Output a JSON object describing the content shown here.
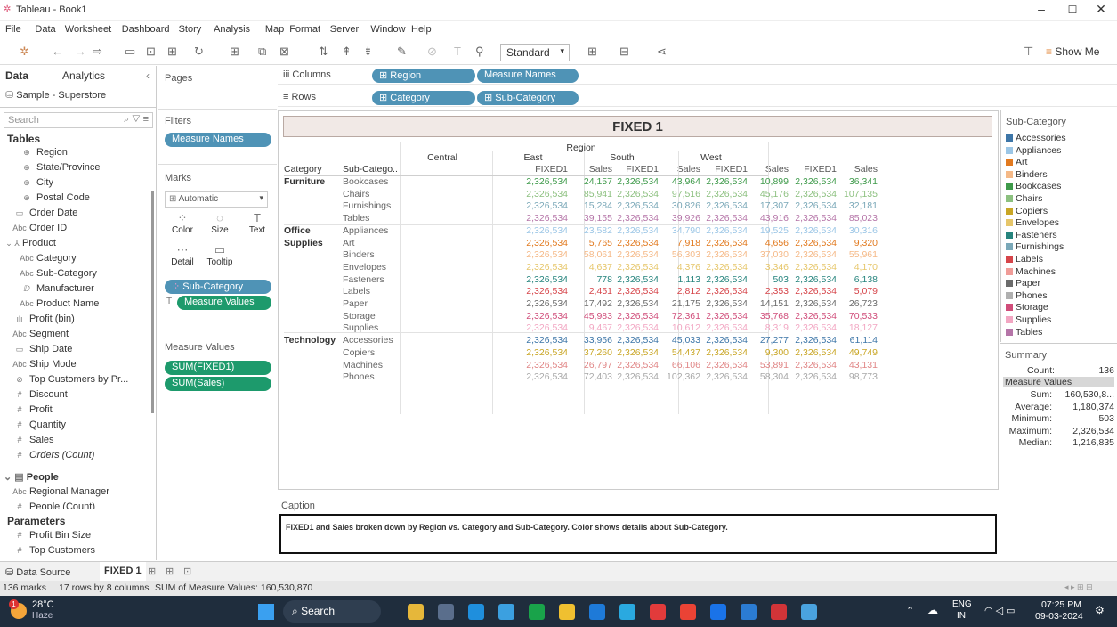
{
  "window": {
    "title": "Tableau - Book1",
    "minimize": "–",
    "maximize": "☐",
    "close": "✕"
  },
  "menu": [
    "File",
    "Data",
    "Worksheet",
    "Dashboard",
    "Story",
    "Analysis",
    "Map",
    "Format",
    "Server",
    "Window",
    "Help"
  ],
  "toolbar": {
    "mark_type": "Standard",
    "show_me": "Show Me"
  },
  "data_pane": {
    "tab_data": "Data",
    "tab_analytics": "Analytics",
    "datasource": "Sample - Superstore",
    "search_placeholder": "Search",
    "tables_label": "Tables",
    "fields": [
      {
        "glyph": "⊕",
        "label": "Region",
        "indent": 2
      },
      {
        "glyph": "⊕",
        "label": "State/Province",
        "indent": 2
      },
      {
        "glyph": "⊕",
        "label": "City",
        "indent": 2
      },
      {
        "glyph": "⊕",
        "label": "Postal Code",
        "indent": 2
      },
      {
        "glyph": "▭",
        "label": "Order Date",
        "indent": 1
      },
      {
        "glyph": "Abc",
        "label": "Order ID",
        "indent": 1
      },
      {
        "glyph": "⌄ ⅄",
        "label": "Product",
        "indent": 0
      },
      {
        "glyph": "Abc",
        "label": "Category",
        "indent": 2
      },
      {
        "glyph": "Abc",
        "label": "Sub-Category",
        "indent": 2
      },
      {
        "glyph": "ⅅ",
        "label": "Manufacturer",
        "indent": 2
      },
      {
        "glyph": "Abc",
        "label": "Product Name",
        "indent": 2
      },
      {
        "glyph": "ılı",
        "label": "Profit (bin)",
        "indent": 1
      },
      {
        "glyph": "Abc",
        "label": "Segment",
        "indent": 1
      },
      {
        "glyph": "▭",
        "label": "Ship Date",
        "indent": 1
      },
      {
        "glyph": "Abc",
        "label": "Ship Mode",
        "indent": 1
      },
      {
        "glyph": "⊘",
        "label": "Top Customers by Pr...",
        "indent": 1
      },
      {
        "glyph": "#",
        "label": "Discount",
        "indent": 1
      },
      {
        "glyph": "#",
        "label": "Profit",
        "indent": 1
      },
      {
        "glyph": "#",
        "label": "Quantity",
        "indent": 1
      },
      {
        "glyph": "#",
        "label": "Sales",
        "indent": 1
      },
      {
        "glyph": "#",
        "label": "Orders (Count)",
        "indent": 1,
        "italic": true
      }
    ],
    "people_label": "People",
    "people_fields": [
      {
        "glyph": "Abc",
        "label": "Regional Manager"
      },
      {
        "glyph": "#",
        "label": "People (Count)"
      }
    ],
    "parameters_label": "Parameters",
    "parameters": [
      "Profit Bin Size",
      "Top Customers"
    ]
  },
  "cards": {
    "pages": "Pages",
    "filters": "Filters",
    "filter_pill": "Measure Names",
    "marks": "Marks",
    "mark_type": "Automatic",
    "mark_buttons": [
      {
        "icon": "⁘",
        "label": "Color"
      },
      {
        "icon": "◌",
        "label": "Size"
      },
      {
        "icon": "T",
        "label": "Text"
      },
      {
        "icon": "⋯",
        "label": "Detail"
      },
      {
        "icon": "▭",
        "label": "Tooltip"
      }
    ],
    "color_pill": "Sub-Category",
    "text_pill": "Measure Values",
    "measure_values": "Measure Values",
    "mv_pills": [
      "SUM(FIXED1)",
      "SUM(Sales)"
    ]
  },
  "shelves": {
    "columns_label": "Columns",
    "rows_label": "Rows",
    "columns": [
      "Region",
      "Measure Names"
    ],
    "rows": [
      "Category",
      "Sub-Category"
    ]
  },
  "view": {
    "title": "FIXED 1",
    "region_header": "Region",
    "category_header": "Category",
    "subcat_header": "Sub-Catego..",
    "regions": [
      "Central",
      "East",
      "South",
      "West"
    ],
    "measures": [
      "FIXED1",
      "Sales"
    ],
    "rows": [
      {
        "cat": "Furniture",
        "sub": "Bookcases",
        "color": "#3e9a4a",
        "vals": [
          "2,326,534",
          "24,157",
          "2,326,534",
          "43,964",
          "2,326,534",
          "10,899",
          "2,326,534",
          "36,341"
        ]
      },
      {
        "cat": "",
        "sub": "Chairs",
        "color": "#8cc07f",
        "vals": [
          "2,326,534",
          "85,941",
          "2,326,534",
          "97,516",
          "2,326,534",
          "45,176",
          "2,326,534",
          "107,135"
        ]
      },
      {
        "cat": "",
        "sub": "Furnishings",
        "color": "#7aa8b8",
        "vals": [
          "2,326,534",
          "15,284",
          "2,326,534",
          "30,826",
          "2,326,534",
          "17,307",
          "2,326,534",
          "32,181"
        ]
      },
      {
        "cat": "",
        "sub": "Tables",
        "color": "#b575a8",
        "vals": [
          "2,326,534",
          "39,155",
          "2,326,534",
          "39,926",
          "2,326,534",
          "43,916",
          "2,326,534",
          "85,023"
        ]
      },
      {
        "cat": "Office",
        "sub": "Appliances",
        "color": "#9bc6e6",
        "vals": [
          "2,326,534",
          "23,582",
          "2,326,534",
          "34,790",
          "2,326,534",
          "19,525",
          "2,326,534",
          "30,316"
        ]
      },
      {
        "cat": "Supplies",
        "sub": "Art",
        "color": "#e27a1f",
        "vals": [
          "2,326,534",
          "5,765",
          "2,326,534",
          "7,918",
          "2,326,534",
          "4,656",
          "2,326,534",
          "9,320"
        ]
      },
      {
        "cat": "",
        "sub": "Binders",
        "color": "#f5b987",
        "vals": [
          "2,326,534",
          "58,061",
          "2,326,534",
          "56,303",
          "2,326,534",
          "37,030",
          "2,326,534",
          "55,961"
        ]
      },
      {
        "cat": "",
        "sub": "Envelopes",
        "color": "#e6c66a",
        "vals": [
          "2,326,534",
          "4,637",
          "2,326,534",
          "4,376",
          "2,326,534",
          "3,346",
          "2,326,534",
          "4,170"
        ]
      },
      {
        "cat": "",
        "sub": "Fasteners",
        "color": "#26847d",
        "vals": [
          "2,326,534",
          "778",
          "2,326,534",
          "1,113",
          "2,326,534",
          "503",
          "2,326,534",
          "6,138"
        ]
      },
      {
        "cat": "",
        "sub": "Labels",
        "color": "#d6454a",
        "vals": [
          "2,326,534",
          "2,451",
          "2,326,534",
          "2,812",
          "2,326,534",
          "2,353",
          "2,326,534",
          "5,079"
        ]
      },
      {
        "cat": "",
        "sub": "Paper",
        "color": "#6b6b6b",
        "vals": [
          "2,326,534",
          "17,492",
          "2,326,534",
          "21,175",
          "2,326,534",
          "14,151",
          "2,326,534",
          "26,723"
        ]
      },
      {
        "cat": "",
        "sub": "Storage",
        "color": "#d04d7a",
        "vals": [
          "2,326,534",
          "45,983",
          "2,326,534",
          "72,361",
          "2,326,534",
          "35,768",
          "2,326,534",
          "70,533"
        ]
      },
      {
        "cat": "",
        "sub": "Supplies",
        "color": "#f2a6c2",
        "vals": [
          "2,326,534",
          "9,467",
          "2,326,534",
          "10,612",
          "2,326,534",
          "8,319",
          "2,326,534",
          "18,127"
        ]
      },
      {
        "cat": "Technology",
        "sub": "Accessories",
        "color": "#3d76a8",
        "vals": [
          "2,326,534",
          "33,956",
          "2,326,534",
          "45,033",
          "2,326,534",
          "27,277",
          "2,326,534",
          "61,114"
        ]
      },
      {
        "cat": "",
        "sub": "Copiers",
        "color": "#c9a625",
        "vals": [
          "2,326,534",
          "37,260",
          "2,326,534",
          "54,437",
          "2,326,534",
          "9,300",
          "2,326,534",
          "49,749"
        ]
      },
      {
        "cat": "",
        "sub": "Machines",
        "color": "#e08585",
        "vals": [
          "2,326,534",
          "26,797",
          "2,326,534",
          "66,106",
          "2,326,534",
          "53,891",
          "2,326,534",
          "43,131"
        ]
      },
      {
        "cat": "",
        "sub": "Phones",
        "color": "#a8a8a8",
        "vals": [
          "2,326,534",
          "72,403",
          "2,326,534",
          "102,362",
          "2,326,534",
          "58,304",
          "2,326,534",
          "98,773"
        ]
      }
    ]
  },
  "legend": {
    "title": "Sub-Category",
    "items": [
      {
        "label": "Accessories",
        "color": "#3d76a8"
      },
      {
        "label": "Appliances",
        "color": "#9bc6e6"
      },
      {
        "label": "Art",
        "color": "#e27a1f"
      },
      {
        "label": "Binders",
        "color": "#f5b987"
      },
      {
        "label": "Bookcases",
        "color": "#3e9a4a"
      },
      {
        "label": "Chairs",
        "color": "#8cc07f"
      },
      {
        "label": "Copiers",
        "color": "#c9a625"
      },
      {
        "label": "Envelopes",
        "color": "#e6c66a"
      },
      {
        "label": "Fasteners",
        "color": "#26847d"
      },
      {
        "label": "Furnishings",
        "color": "#7aa8b8"
      },
      {
        "label": "Labels",
        "color": "#d6454a"
      },
      {
        "label": "Machines",
        "color": "#f09c98"
      },
      {
        "label": "Paper",
        "color": "#6b6b6b"
      },
      {
        "label": "Phones",
        "color": "#b0b0b0"
      },
      {
        "label": "Storage",
        "color": "#d04d7a"
      },
      {
        "label": "Supplies",
        "color": "#f2a6c2"
      },
      {
        "label": "Tables",
        "color": "#b575a8"
      }
    ]
  },
  "summary": {
    "title": "Summary",
    "count_label": "Count:",
    "count": "136",
    "mv_header": "Measure Values",
    "stats": [
      {
        "label": "Sum:",
        "value": "160,530,8..."
      },
      {
        "label": "Average:",
        "value": "1,180,374"
      },
      {
        "label": "Minimum:",
        "value": "503"
      },
      {
        "label": "Maximum:",
        "value": "2,326,534"
      },
      {
        "label": "Median:",
        "value": "1,216,835"
      }
    ]
  },
  "caption": {
    "label": "Caption",
    "text": "FIXED1 and Sales broken down by Region vs. Category and Sub-Category.  Color shows details about Sub-Category."
  },
  "sheet_tabs": {
    "datasource": "Data Source",
    "sheet": "FIXED 1"
  },
  "status": {
    "marks": "136 marks",
    "dims": "17 rows by 8 columns",
    "sum": "SUM of Measure Values: 160,530,870"
  },
  "taskbar": {
    "temp": "28°C",
    "weather": "Haze",
    "badge": "1",
    "search": "Search",
    "lang1": "ENG",
    "lang2": "IN",
    "time": "07:25 PM",
    "date": "09-03-2024"
  }
}
